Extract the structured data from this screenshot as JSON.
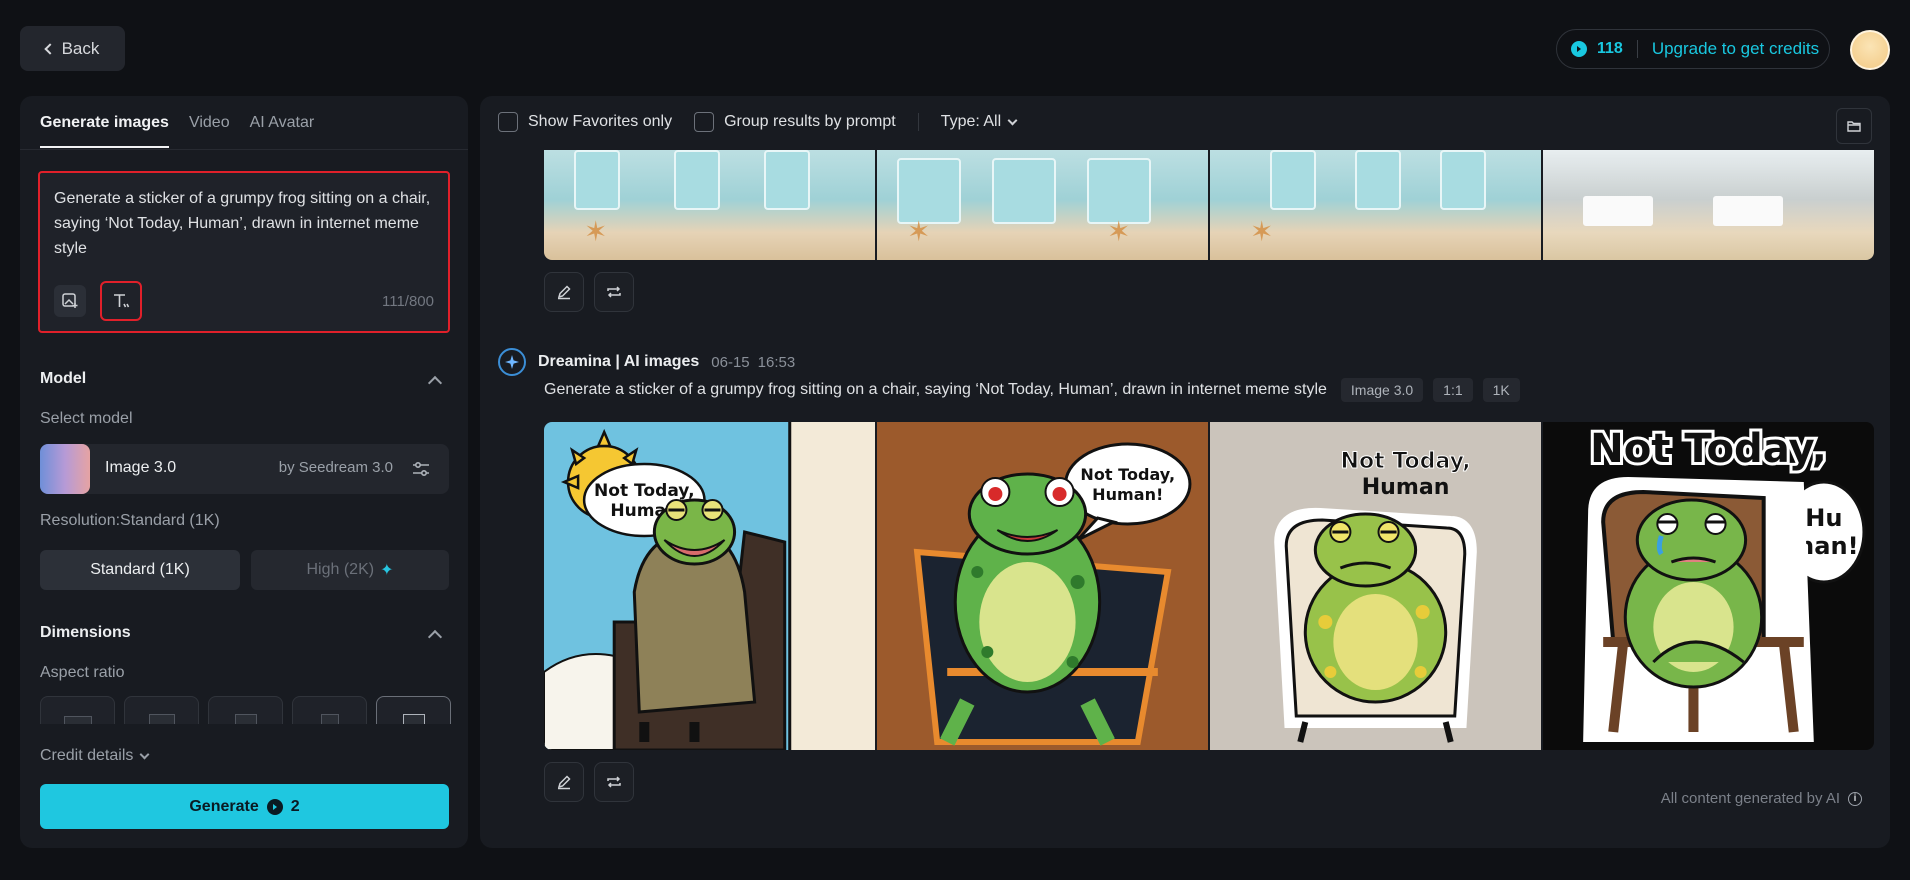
{
  "header": {
    "back_label": "Back",
    "credits": "118",
    "upgrade_label": "Upgrade to get credits"
  },
  "left": {
    "tabs": [
      {
        "label": "Generate images",
        "active": true
      },
      {
        "label": "Video",
        "active": false
      },
      {
        "label": "AI Avatar",
        "active": false
      }
    ],
    "prompt": "Generate a sticker of a grumpy frog sitting on a chair, saying ‘Not Today, Human’, drawn in internet meme style",
    "char_count": "111/800",
    "model_section": "Model",
    "select_model_label": "Select model",
    "model_name": "Image 3.0",
    "model_by": "by Seedream 3.0",
    "resolution_label": "Resolution:Standard (1K)",
    "res_standard": "Standard (1K)",
    "res_high": "High (2K)",
    "dimensions_section": "Dimensions",
    "aspect_label": "Aspect ratio",
    "credit_details": "Credit details",
    "generate_label": "Generate",
    "generate_cost": "2"
  },
  "right": {
    "show_favorites": "Show Favorites only",
    "group_by_prompt": "Group results by prompt",
    "type_filter": "Type: All",
    "result": {
      "source": "Dreamina | AI images",
      "date": "06-15",
      "time": "16:53",
      "prompt": "Generate a sticker of a grumpy frog sitting on a chair, saying ‘Not Today, Human’, drawn in internet meme style",
      "tags": [
        "Image 3.0",
        "1:1",
        "1K"
      ]
    },
    "image_texts": {
      "img1_line1": "Not Today,",
      "img1_line2": "Human",
      "img2_line1": "Not Today,",
      "img2_line2": "Human!",
      "img3_line1": "Not Today,",
      "img3_line2": "Human",
      "img4_line1": "Not Today,",
      "img4_line2": "Hu",
      "img4_line3": "man!"
    },
    "footnote": "All content generated by AI"
  },
  "colors": {
    "accent": "#1fc7e0",
    "highlight_border": "#e0202a",
    "background": "#0f1115",
    "panel": "#181b21"
  }
}
